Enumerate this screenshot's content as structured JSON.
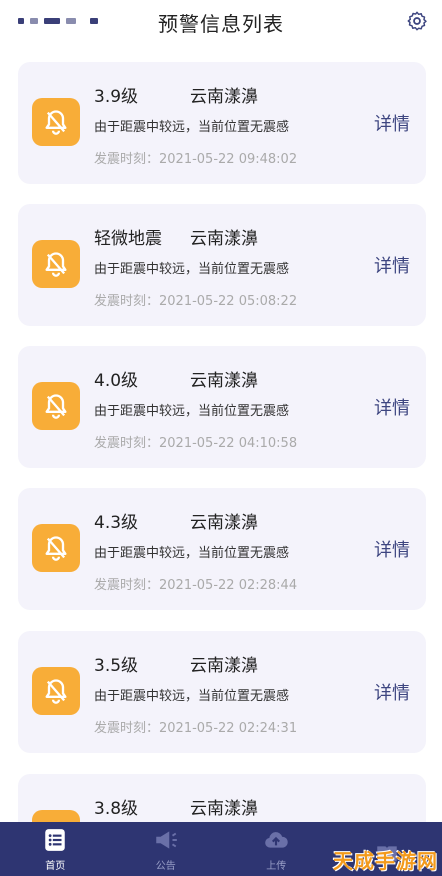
{
  "header": {
    "title": "预警信息列表",
    "menu_icon": "menu-dots-icon",
    "settings_icon": "gear-icon"
  },
  "colors": {
    "accent_orange": "#f8ad38",
    "nav_bg": "#2e3572",
    "detail_text": "#3d4580",
    "card_bg": "#f4f3fb"
  },
  "alerts": [
    {
      "level": "3.9级",
      "location": "云南漾濞",
      "message": "由于距震中较远，当前位置无震感",
      "time_label": "发震时刻：",
      "time": "2021-05-22 09:48:02",
      "detail": "详情"
    },
    {
      "level": "轻微地震",
      "location": "云南漾濞",
      "message": "由于距震中较远，当前位置无震感",
      "time_label": "发震时刻：",
      "time": "2021-05-22 05:08:22",
      "detail": "详情"
    },
    {
      "level": "4.0级",
      "location": "云南漾濞",
      "message": "由于距震中较远，当前位置无震感",
      "time_label": "发震时刻：",
      "time": "2021-05-22 04:10:58",
      "detail": "详情"
    },
    {
      "level": "4.3级",
      "location": "云南漾濞",
      "message": "由于距震中较远，当前位置无震感",
      "time_label": "发震时刻：",
      "time": "2021-05-22 02:28:44",
      "detail": "详情"
    },
    {
      "level": "3.5级",
      "location": "云南漾濞",
      "message": "由于距震中较远，当前位置无震感",
      "time_label": "发震时刻：",
      "time": "2021-05-22 02:24:31",
      "detail": "详情"
    },
    {
      "level": "3.8级",
      "location": "云南漾濞",
      "message": "",
      "time_label": "",
      "time": "",
      "detail": ""
    }
  ],
  "nav": [
    {
      "label": "首页",
      "icon": "list-icon",
      "active": true
    },
    {
      "label": "公告",
      "icon": "megaphone-icon",
      "active": false
    },
    {
      "label": "上传",
      "icon": "cloud-upload-icon",
      "active": false
    },
    {
      "label": "",
      "icon": "book-icon",
      "active": false
    }
  ],
  "watermark": "天成手游网"
}
